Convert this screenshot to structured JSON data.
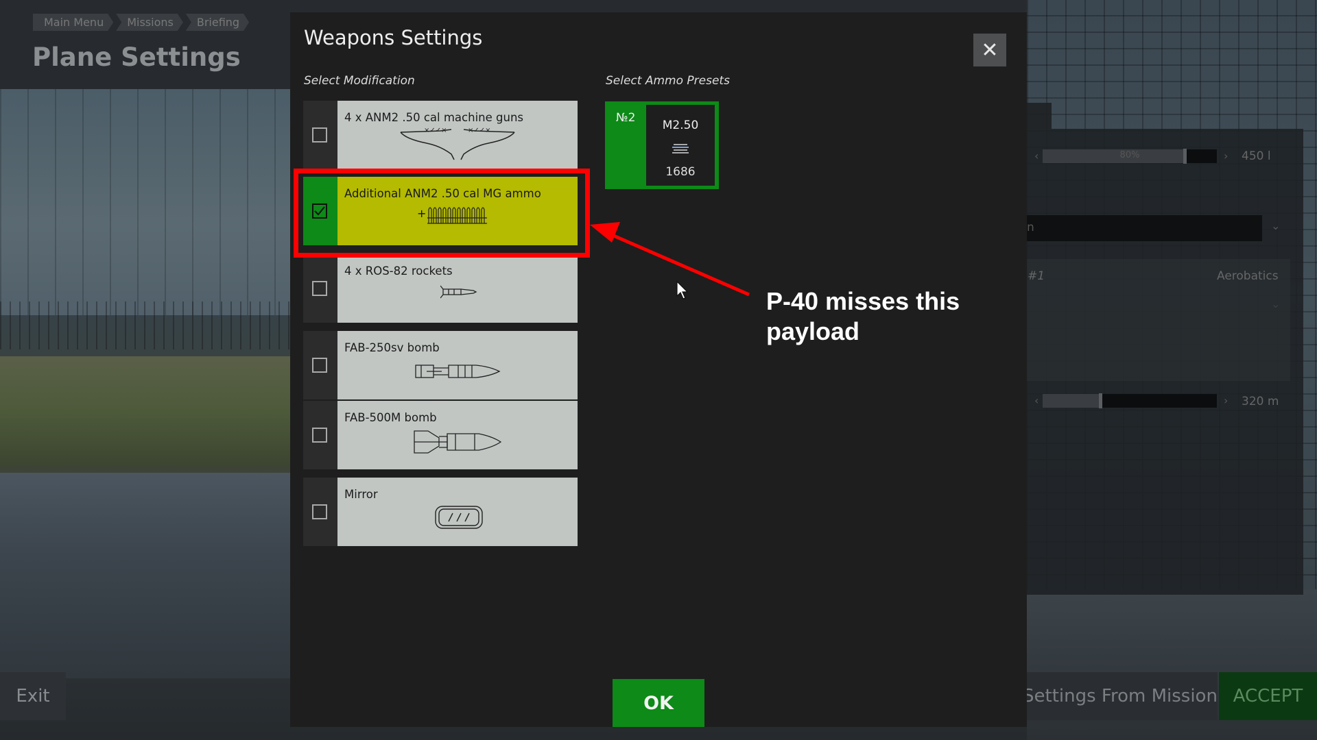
{
  "breadcrumb": [
    "Main Menu",
    "Missions",
    "Briefing"
  ],
  "page_title": "Plane Settings",
  "bottom_bar": {
    "exit_label": "Exit",
    "settings_from_mission_label": "Settings From Mission",
    "accept_label": "ACCEPT"
  },
  "background_panel": {
    "fuel_percent_label": "80%",
    "fuel_value": "450 l",
    "skin_value": "n",
    "preset_label": "#1",
    "preset_value": "Aerobatics",
    "altitude_value": "320 m"
  },
  "modal": {
    "title": "Weapons Settings",
    "select_modification_label": "Select Modification",
    "select_ammo_label": "Select Ammo Presets",
    "modifications": [
      {
        "label": "4 x ANM2 .50 cal machine guns",
        "checked": false,
        "icon": "wing-guns-icon"
      },
      {
        "label": "Additional ANM2 .50 cal MG ammo",
        "checked": true,
        "icon": "ammo-belt-icon",
        "prefix": "+"
      },
      {
        "label": "4 x ROS-82 rockets",
        "checked": false,
        "icon": "rocket-icon"
      },
      {
        "label": "FAB-250sv bomb",
        "checked": false,
        "icon": "small-bomb-icon"
      },
      {
        "label": "FAB-500M bomb",
        "checked": false,
        "icon": "large-bomb-icon"
      },
      {
        "label": "Mirror",
        "checked": false,
        "icon": "mirror-icon"
      }
    ],
    "ammo_preset": {
      "number": "№2",
      "name": "M2.50",
      "count": "1686"
    },
    "ok_label": "OK"
  },
  "annotation": {
    "text": "P-40 misses this payload",
    "color": "#ff0000"
  },
  "colors": {
    "selected_green": "#0d8a17",
    "selected_yellow": "#b4bb00",
    "highlight_red": "#ff0000"
  }
}
